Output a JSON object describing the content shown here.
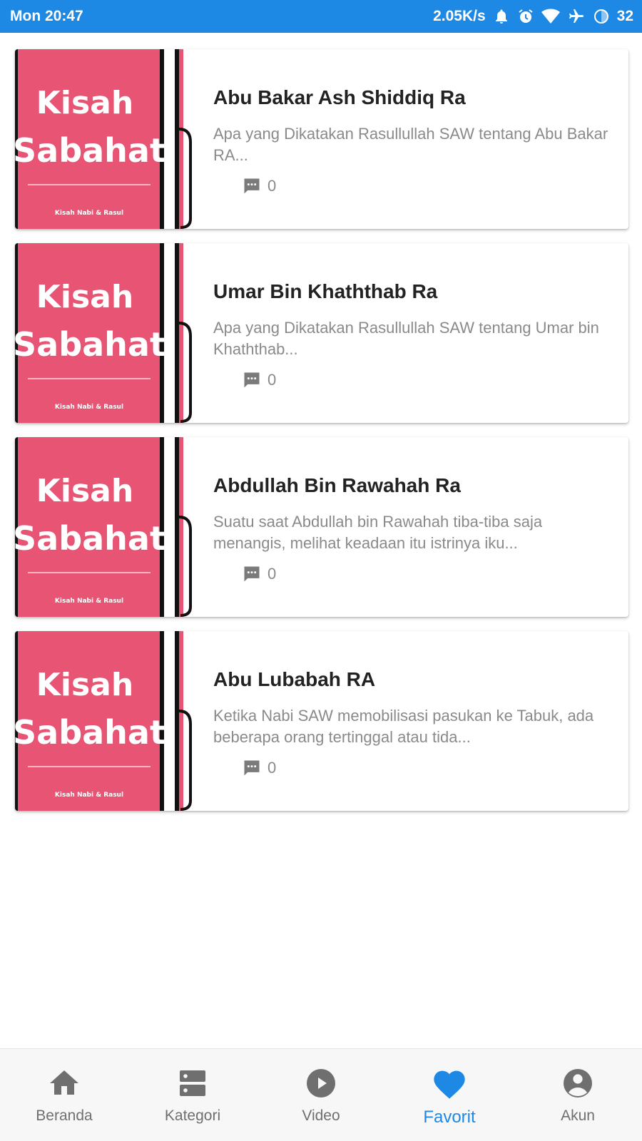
{
  "status": {
    "time": "Mon 20:47",
    "speed": "2.05K/s",
    "battery": "32",
    "icons": [
      "bell-icon",
      "alarm-icon",
      "wifi-icon",
      "airplane-icon",
      "battery-icon"
    ]
  },
  "colors": {
    "accent": "#1e88e5",
    "thumb_pink": "#e85473"
  },
  "thumbnail": {
    "line1": "Kisah",
    "line2": "Sabahat",
    "footer": "Kisah Nabi & Rasul"
  },
  "articles": [
    {
      "title": "Abu Bakar Ash Shiddiq Ra",
      "excerpt": "Apa yang Dikatakan Rasullullah SAW tentang Abu Bakar RA...",
      "comments": "0"
    },
    {
      "title": "Umar Bin Khaththab Ra",
      "excerpt": "Apa yang Dikatakan Rasullullah SAW tentang Umar bin Khaththab...",
      "comments": "0"
    },
    {
      "title": "Abdullah Bin Rawahah Ra",
      "excerpt": "Suatu saat Abdullah bin Rawahah tiba-tiba saja menangis, melihat keadaan itu istrinya iku...",
      "comments": "0"
    },
    {
      "title": "Abu Lubabah RA",
      "excerpt": "Ketika Nabi SAW memobilisasi pasukan ke Tabuk, ada beberapa orang tertinggal atau tida...",
      "comments": "0"
    }
  ],
  "nav": {
    "items": [
      {
        "label": "Beranda",
        "icon": "home-icon"
      },
      {
        "label": "Kategori",
        "icon": "category-icon"
      },
      {
        "label": "Video",
        "icon": "play-icon"
      },
      {
        "label": "Favorit",
        "icon": "heart-icon"
      },
      {
        "label": "Akun",
        "icon": "account-icon"
      }
    ],
    "active": "Favorit"
  }
}
